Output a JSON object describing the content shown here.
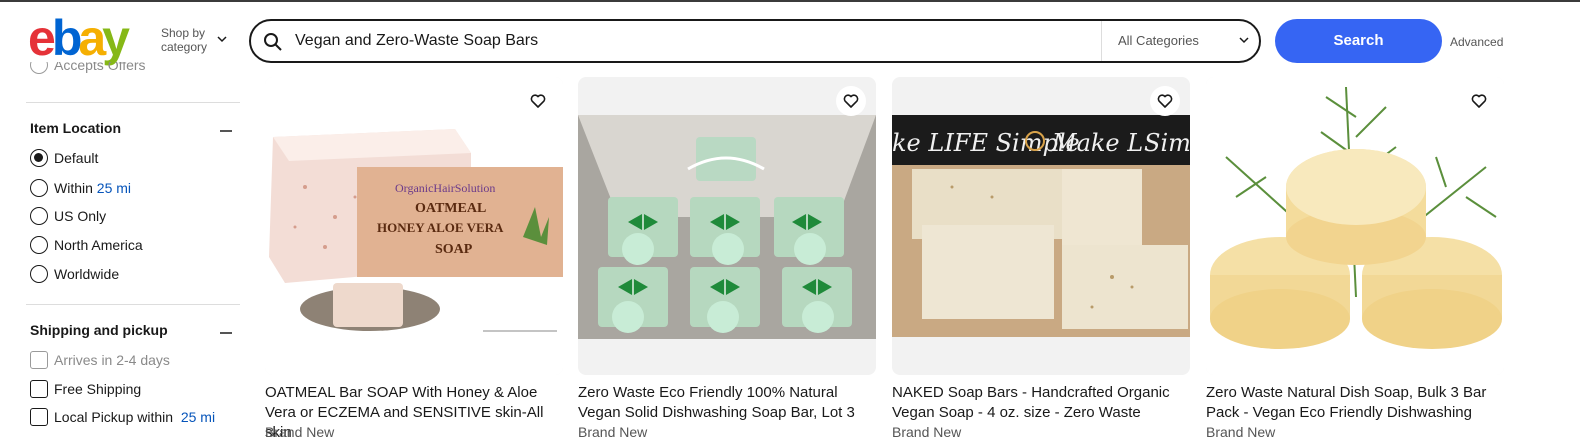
{
  "header": {
    "logo": {
      "e": "e",
      "b": "b",
      "a": "a",
      "y": "y"
    },
    "shop_by_line1": "Shop by",
    "shop_by_line2": "category",
    "search_value": "Vegan and Zero-Waste Soap Bars",
    "category_select": "All Categories",
    "search_button": "Search",
    "advanced_link": "Advanced"
  },
  "sidebar": {
    "partial_option": "Accepts Offers",
    "item_location": {
      "title": "Item Location",
      "options": [
        {
          "label": "Default",
          "selected": true
        },
        {
          "label": "Within",
          "link": "25 mi",
          "selected": false
        },
        {
          "label": "US Only",
          "selected": false
        },
        {
          "label": "North America",
          "selected": false
        },
        {
          "label": "Worldwide",
          "selected": false
        }
      ]
    },
    "shipping": {
      "title": "Shipping and pickup",
      "options": [
        {
          "label": "Arrives in 2-4 days",
          "disabled": true
        },
        {
          "label": "Free Shipping",
          "disabled": false
        },
        {
          "label": "Local Pickup within",
          "link": "25 mi",
          "disabled": false
        }
      ]
    }
  },
  "listings": [
    {
      "title": "OATMEAL Bar SOAP With Honey & Aloe Vera or ECZEMA and SENSITIVE skin-All skin",
      "condition": "Brand New",
      "image_text": {
        "brand": "OrganicHairSolution",
        "line1": "OATMEAL",
        "line2": "HONEY ALOE VERA",
        "line3": "SOAP"
      }
    },
    {
      "title": "Zero Waste Eco Friendly 100% Natural Vegan Solid Dishwashing Soap Bar, Lot 3",
      "condition": "Brand New"
    },
    {
      "title": "NAKED Soap Bars - Handcrafted Organic Vegan Soap - 4 oz. size - Zero Waste",
      "condition": "Brand New",
      "image_text": {
        "sign1": "ke LIFE Simple",
        "sign2": "Make L",
        "sign3": "Simp"
      }
    },
    {
      "title": "Zero Waste Natural Dish Soap, Bulk 3 Bar Pack - Vegan Eco Friendly Dishwashing",
      "condition": "Brand New"
    }
  ],
  "colors": {
    "accent": "#3665f3",
    "link": "#0654ba"
  }
}
